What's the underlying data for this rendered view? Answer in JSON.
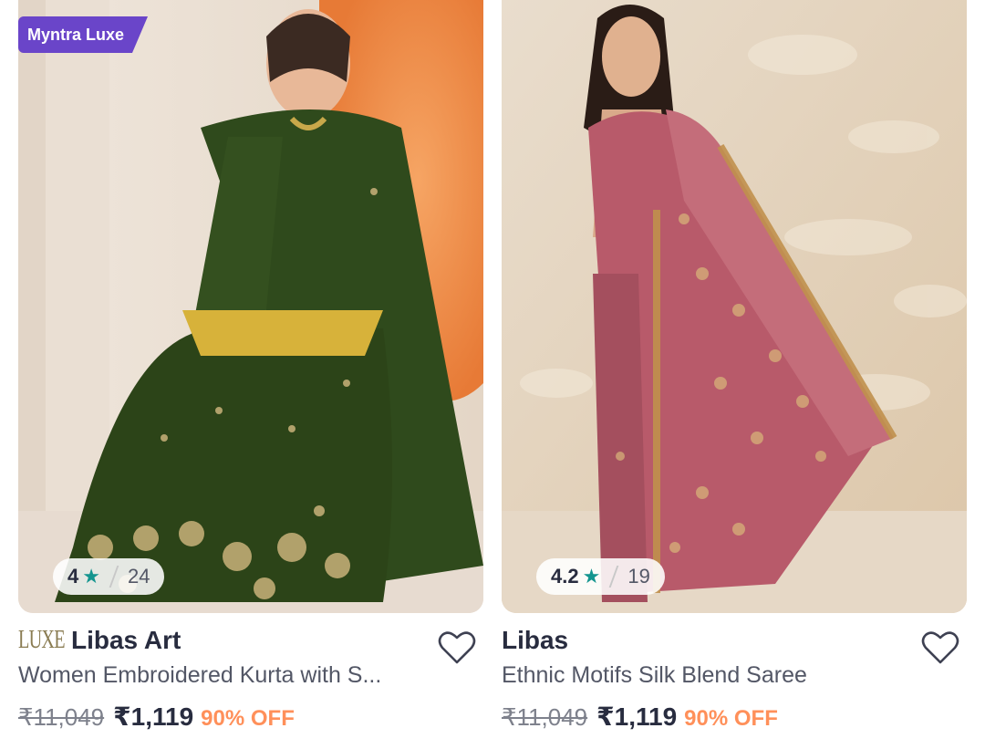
{
  "products": [
    {
      "badge": "Myntra Luxe",
      "rating": "4",
      "rating_count": "24",
      "brand_logo": "LUXE",
      "brand": "Libas Art",
      "title": "Women Embroidered Kurta with S...",
      "mrp": "₹11,049",
      "price": "₹1,119",
      "discount": "90% OFF"
    },
    {
      "rating": "4.2",
      "rating_count": "19",
      "brand": "Libas",
      "title": "Ethnic Motifs Silk Blend Saree",
      "mrp": "₹11,049",
      "price": "₹1,119",
      "discount": "90% OFF"
    }
  ],
  "icons": {
    "star": "★",
    "wishlist": "heart-outline-icon"
  },
  "colors": {
    "luxe_badge": "#6a45c9",
    "star": "#14958f",
    "discount": "#ff905a",
    "text_primary": "#282c3f",
    "text_secondary": "#535766"
  }
}
